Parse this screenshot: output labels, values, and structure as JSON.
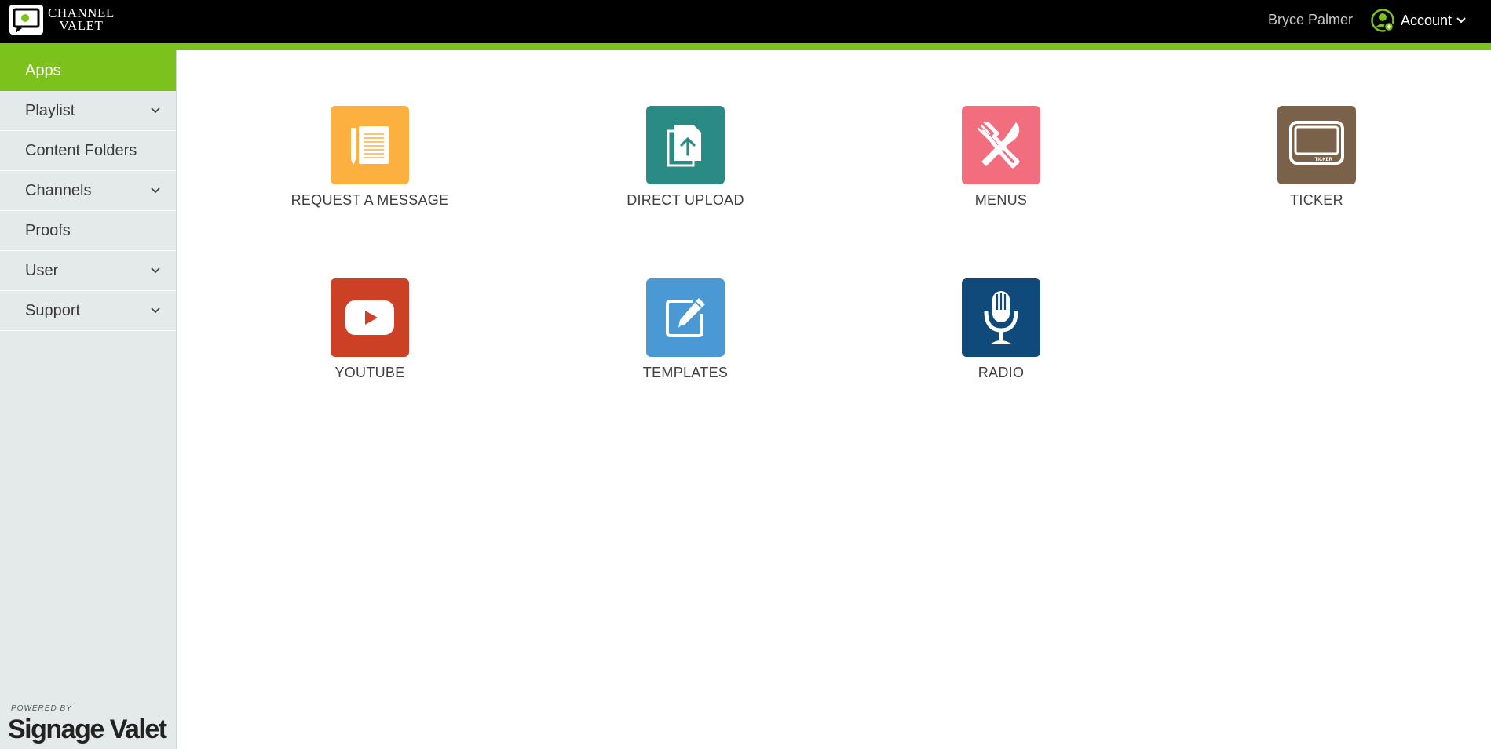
{
  "header": {
    "logo_line1": "CHANNEL",
    "logo_line2": "VALET",
    "user_name": "Bryce Palmer",
    "account_label": "Account"
  },
  "sidebar": {
    "items": [
      {
        "label": "Apps",
        "active": true,
        "expandable": false
      },
      {
        "label": "Playlist",
        "active": false,
        "expandable": true
      },
      {
        "label": "Content Folders",
        "active": false,
        "expandable": false
      },
      {
        "label": "Channels",
        "active": false,
        "expandable": true
      },
      {
        "label": "Proofs",
        "active": false,
        "expandable": false
      },
      {
        "label": "User",
        "active": false,
        "expandable": true
      },
      {
        "label": "Support",
        "active": false,
        "expandable": true
      }
    ],
    "powered_by": "POWERED BY",
    "brand": "Signage Valet"
  },
  "apps": [
    {
      "label": "REQUEST A MESSAGE",
      "icon": "notepad-pencil-icon",
      "color": "#fbb040"
    },
    {
      "label": "DIRECT UPLOAD",
      "icon": "upload-document-icon",
      "color": "#2a8a84"
    },
    {
      "label": "MENUS",
      "icon": "fork-knife-icon",
      "color": "#f26d7d"
    },
    {
      "label": "TICKER",
      "icon": "ticker-screen-icon",
      "color": "#7a614a"
    },
    {
      "label": "YOUTUBE",
      "icon": "youtube-play-icon",
      "color": "#cc4125"
    },
    {
      "label": "TEMPLATES",
      "icon": "edit-pencil-icon",
      "color": "#4a98d4"
    },
    {
      "label": "RADIO",
      "icon": "microphone-icon",
      "color": "#0f4a7a"
    }
  ],
  "colors": {
    "accent_green": "#7dc11c",
    "topbar": "#000000",
    "sidebar_bg": "#e4e9e9"
  },
  "ticker_tag": "TICKER"
}
